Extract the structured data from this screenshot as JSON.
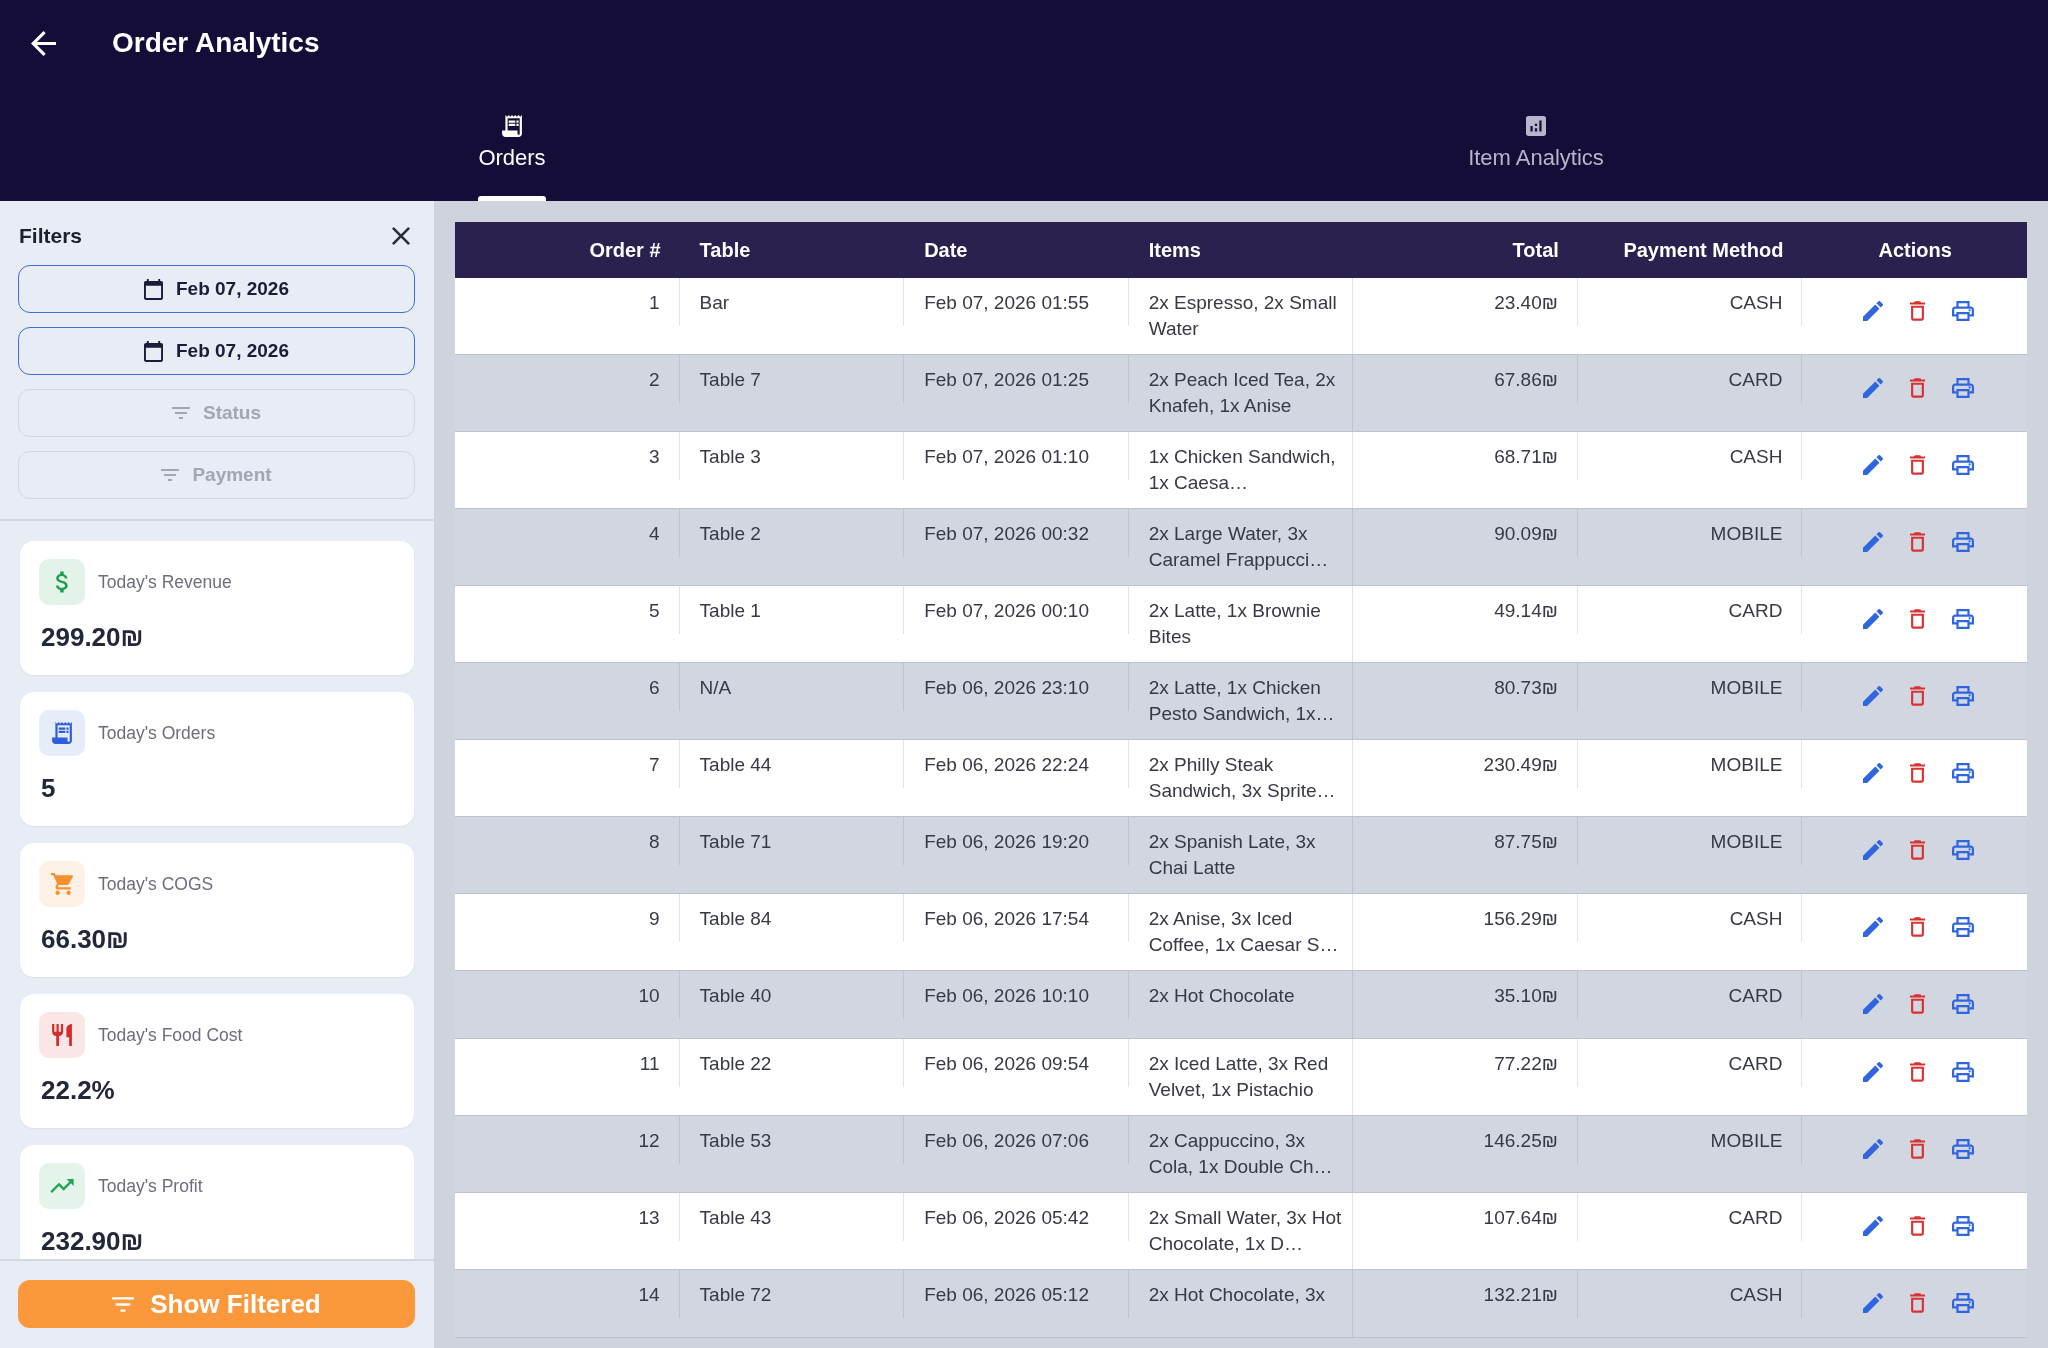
{
  "header": {
    "title": "Order Analytics"
  },
  "tabs": [
    {
      "kind": "orders",
      "label": "Orders",
      "selected": true
    },
    {
      "kind": "analytics",
      "label": "Item Analytics",
      "selected": false
    }
  ],
  "sidebar": {
    "title": "Filters",
    "filters": [
      {
        "kind": "date",
        "label": "Feb 07, 2026",
        "active": true
      },
      {
        "kind": "date",
        "label": "Feb 07, 2026",
        "active": true
      },
      {
        "kind": "select",
        "label": "Status",
        "active": false
      },
      {
        "kind": "select",
        "label": "Payment",
        "active": false
      }
    ],
    "stats": [
      {
        "kind": "revenue",
        "label": "Today's Revenue",
        "value": "299.20₪",
        "color": "#1f9d4f"
      },
      {
        "kind": "orders",
        "label": "Today's Orders",
        "value": "5",
        "color": "#2f5fd8"
      },
      {
        "kind": "cogs",
        "label": "Today's COGS",
        "value": "66.30₪",
        "color": "#f5902e"
      },
      {
        "kind": "food_cost",
        "label": "Today's Food Cost",
        "value": "22.2%",
        "color": "#d42b2b"
      },
      {
        "kind": "profit",
        "label": "Today's Profit",
        "value": "232.90₪",
        "color": "#22a355"
      }
    ],
    "apply_button": {
      "label": "Show Filtered"
    }
  },
  "table": {
    "columns": [
      {
        "kind": "end",
        "label": "Order #"
      },
      {
        "kind": "start",
        "label": "Table"
      },
      {
        "kind": "start",
        "label": "Date"
      },
      {
        "kind": "multiline",
        "label": "Items"
      },
      {
        "kind": "end",
        "label": "Total"
      },
      {
        "kind": "end",
        "label": "Payment Method"
      },
      {
        "kind": "actions",
        "label": "Actions"
      }
    ],
    "rows": [
      {
        "cells": [
          "1",
          "Bar",
          "Feb 07, 2026 01:55",
          "2x Espresso, 2x Small Water",
          "23.40₪",
          "CASH"
        ]
      },
      {
        "cells": [
          "2",
          "Table 7",
          "Feb 07, 2026 01:25",
          "2x Peach Iced Tea, 2x Knafeh, 1x Anise",
          "67.86₪",
          "CARD"
        ]
      },
      {
        "cells": [
          "3",
          "Table 3",
          "Feb 07, 2026 01:10",
          "1x Chicken Sandwich, 1x Caesa…",
          "68.71₪",
          "CASH"
        ]
      },
      {
        "cells": [
          "4",
          "Table 2",
          "Feb 07, 2026 00:32",
          "2x Large Water, 3x Caramel Frappucci…",
          "90.09₪",
          "MOBILE"
        ]
      },
      {
        "cells": [
          "5",
          "Table 1",
          "Feb 07, 2026 00:10",
          "2x Latte, 1x Brownie Bites",
          "49.14₪",
          "CARD"
        ]
      },
      {
        "cells": [
          "6",
          "N/A",
          "Feb 06, 2026 23:10",
          "2x Latte, 1x Chicken Pesto Sandwich, 1x…",
          "80.73₪",
          "MOBILE"
        ]
      },
      {
        "cells": [
          "7",
          "Table 44",
          "Feb 06, 2026 22:24",
          "2x Philly Steak Sandwich, 3x Sprite…",
          "230.49₪",
          "MOBILE"
        ]
      },
      {
        "cells": [
          "8",
          "Table 71",
          "Feb 06, 2026 19:20",
          "2x Spanish Late, 3x Chai Latte",
          "87.75₪",
          "MOBILE"
        ]
      },
      {
        "cells": [
          "9",
          "Table 84",
          "Feb 06, 2026 17:54",
          "2x Anise, 3x Iced Coffee, 1x Caesar S…",
          "156.29₪",
          "CASH"
        ]
      },
      {
        "cells": [
          "10",
          "Table 40",
          "Feb 06, 2026 10:10",
          "2x Hot Chocolate",
          "35.10₪",
          "CARD"
        ]
      },
      {
        "cells": [
          "11",
          "Table 22",
          "Feb 06, 2026 09:54",
          "2x Iced Latte, 3x Red Velvet, 1x Pistachio",
          "77.22₪",
          "CARD"
        ]
      },
      {
        "cells": [
          "12",
          "Table 53",
          "Feb 06, 2026 07:06",
          "2x Cappuccino, 3x Cola, 1x Double Ch…",
          "146.25₪",
          "MOBILE"
        ]
      },
      {
        "cells": [
          "13",
          "Table 43",
          "Feb 06, 2026 05:42",
          "2x Small Water, 3x Hot Chocolate, 1x D…",
          "107.64₪",
          "CARD"
        ]
      },
      {
        "cells": [
          "14",
          "Table 72",
          "Feb 06, 2026 05:12",
          "2x Hot Chocolate, 3x",
          "132.21₪",
          "CASH"
        ]
      }
    ]
  }
}
